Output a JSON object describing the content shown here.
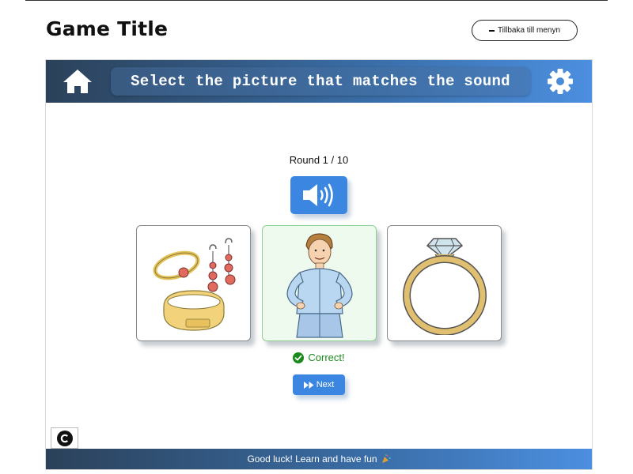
{
  "page": {
    "title": "Game Title",
    "back_label": "Tillbaka till menyn"
  },
  "game": {
    "instruction": "Select the picture that matches the sound",
    "round_label": "Round 1 / 10",
    "cards": [
      {
        "name": "jewelry",
        "state": "normal"
      },
      {
        "name": "man",
        "state": "correct"
      },
      {
        "name": "ring",
        "state": "normal"
      }
    ],
    "feedback": "Correct!",
    "next_label": "Next",
    "footer_text": "Good luck! Learn and have fun",
    "footer_icon": "party-popper-icon"
  },
  "colors": {
    "header_start": "#2b4159",
    "header_end": "#4c8fe0",
    "button_blue": "#3a86e0",
    "correct_green": "#1a8a1a",
    "correct_card_bg": "#eefaee"
  }
}
